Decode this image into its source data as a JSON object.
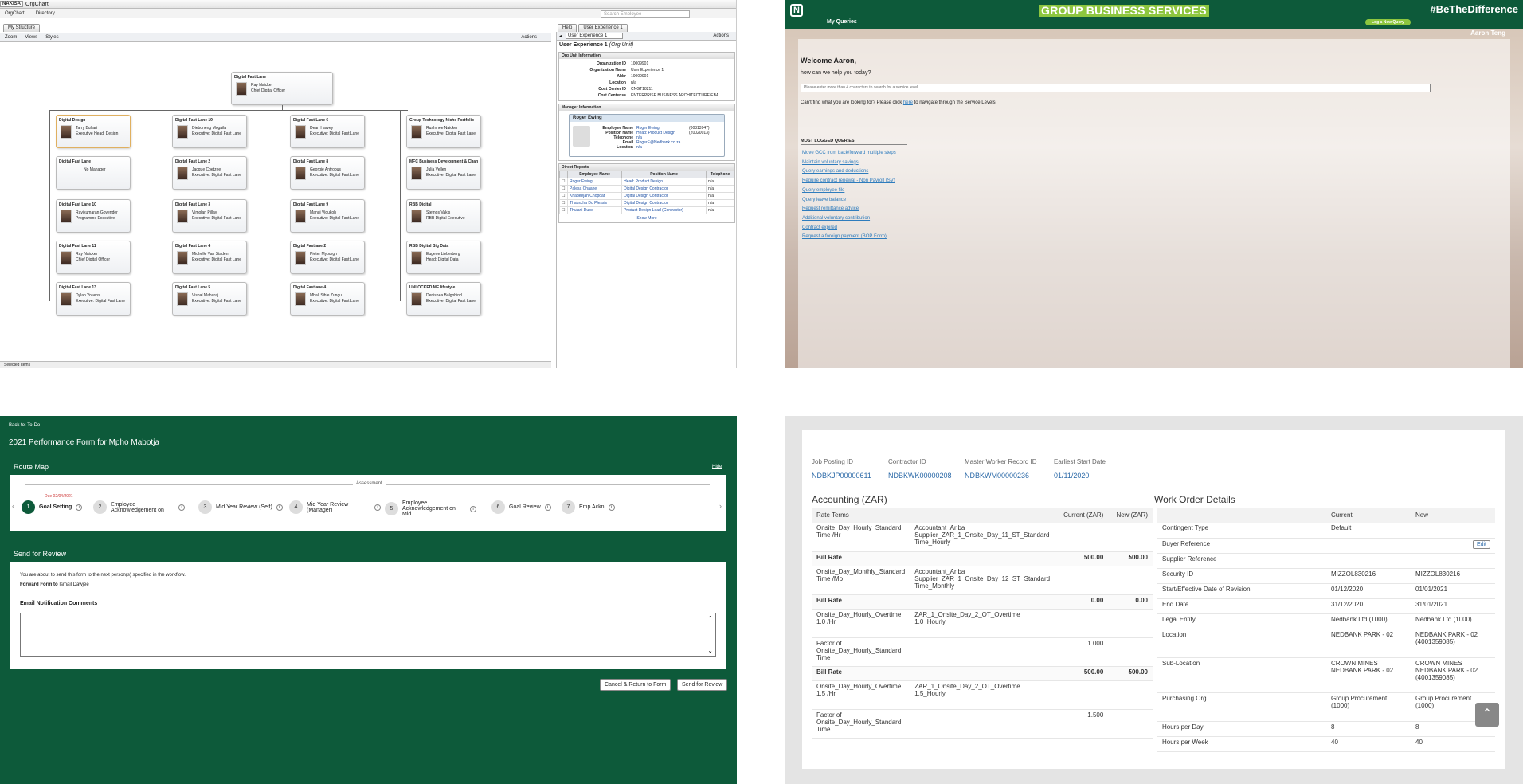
{
  "orgchart": {
    "logo": "NAKISA",
    "app_title": "OrgChart",
    "menu": [
      "OrgChart",
      "Directory"
    ],
    "search_placeholder": "Search Employee",
    "tab_structure": "My Structure",
    "tab_help": "Help",
    "tab_user_exp": "User Experience 1",
    "toolbar": {
      "zoom": "Zoom",
      "views": "Views",
      "styles": "Styles",
      "actions": "Actions"
    },
    "right_actions": "Actions",
    "root": {
      "title": "Digital Fast Lane",
      "name": "Ray Naicker",
      "role": "Chief Digital Officer"
    },
    "columns": [
      [
        {
          "title": "Digital Design",
          "name": "Tarry Buhari",
          "role": "Executive Head: Design"
        },
        {
          "title": "Digital Fast Lane",
          "name": "No Manager",
          "role": ""
        },
        {
          "title": "Digital Fast Lane 10",
          "name": "Ravikumaran Govender",
          "role": "Programme Executive"
        },
        {
          "title": "Digital Fast Lane 11",
          "name": "Ray Naicker",
          "role": "Chief Digital Officer"
        },
        {
          "title": "Digital Fast Lane 13",
          "name": "Dylan Youens",
          "role": "Executive: Digital Fast Lane"
        }
      ],
      [
        {
          "title": "Digital Fast Lane 19",
          "name": "Dieboneng Mogaila",
          "role": "Executive: Digital Fast Lane"
        },
        {
          "title": "Digital Fast Lane 2",
          "name": "Jacque Coetzee",
          "role": "Executive: Digital Fast Lane"
        },
        {
          "title": "Digital Fast Lane 3",
          "name": "Vimolan Pillay",
          "role": "Executive: Digital Fast Lane"
        },
        {
          "title": "Digital Fast Lane 4",
          "name": "Michelle Van Staden",
          "role": "Executive: Digital Fast Lane"
        },
        {
          "title": "Digital Fast Lane 5",
          "name": "Vishal Maharaj",
          "role": "Executive: Digital Fast Lane"
        }
      ],
      [
        {
          "title": "Digital Fast Lane 6",
          "name": "Dean Harvey",
          "role": "Executive: Digital Fast Lane"
        },
        {
          "title": "Digital Fast Lane 8",
          "name": "Georgie Antrobus",
          "role": "Executive: Digital Fast Lane"
        },
        {
          "title": "Digital Fast Lane 9",
          "name": "Manuj Vidukoh",
          "role": "Executive: Digital Fast Lane"
        },
        {
          "title": "Digital Fastlane 2",
          "name": "Pieter Myburgh",
          "role": "Executive: Digital Fast Lane"
        },
        {
          "title": "Digital Fastlane 4",
          "name": "Mbali Sihle Zungu",
          "role": "Executive: Digital Fast Lane"
        }
      ],
      [
        {
          "title": "Group Technology Niche Portfolio",
          "name": "Rushmee Naicker",
          "role": "Executive: Digital Fast Lane"
        },
        {
          "title": "MFC Business Development & Channel...",
          "name": "Julia Vellen",
          "role": "Executive: Digital Fast Lane"
        },
        {
          "title": "RBB Digital",
          "name": "Stefnos Vakis",
          "role": "RBB Digital Executive"
        },
        {
          "title": "RBB Digital Big Data",
          "name": "Eugene Lieberberg",
          "role": "Head: Digital Data"
        },
        {
          "title": "UNLOCKED.ME lifestyle",
          "name": "Denishea Balgobind",
          "role": "Executive: Digital Fast Lane"
        }
      ]
    ],
    "status": "Selected Items",
    "detail": {
      "title": "User Experience 1",
      "subtitle": "(Org Unit)",
      "org_header": "Org Unit Information",
      "org_info": [
        {
          "k": "Organization ID",
          "v": "10009901"
        },
        {
          "k": "Organization Name",
          "v": "User Experience 1"
        },
        {
          "k": "Abbr",
          "v": "10009901"
        },
        {
          "k": "Location",
          "v": "n/a"
        },
        {
          "k": "Cost Center ID",
          "v": "CNGT18211"
        },
        {
          "k": "Cost Center ss",
          "v": "ENTERPRISE BUSINESS ARCHITECTURE/EBA"
        }
      ],
      "mgr_tab": "Manager",
      "mgr_header": "Manager Information",
      "mgr_name": "Roger Ewing",
      "mgr_info": [
        {
          "k": "Employee Name",
          "v": "Roger Ewing",
          "x": "(00313947)"
        },
        {
          "k": "Position Name",
          "v": "Head: Product Design",
          "x": "(20020013)"
        },
        {
          "k": "Telephone",
          "v": "n/a",
          "x": ""
        },
        {
          "k": "Email",
          "v": "RogerE@Nedbank.co.za",
          "x": ""
        },
        {
          "k": "Location",
          "v": "n/a",
          "x": ""
        }
      ],
      "dr_header": "Direct Reports",
      "dr_cols": [
        "Employee Name",
        "Position Name",
        "Telephone"
      ],
      "dr_rows": [
        [
          "Roger Ewing",
          "Head: Product Design",
          "n/a"
        ],
        [
          "Palesa Chaane",
          "Digital Design Contractor",
          "n/a"
        ],
        [
          "Khadeejah Chopdat",
          "Digital Design Contractor",
          "n/a"
        ],
        [
          "Thabscha Du Plessis",
          "Digital Design Contractor",
          "n/a"
        ],
        [
          "Thulani Dube",
          "Product Design Lead (Contractor)",
          "n/a"
        ]
      ],
      "show_more": "Show More"
    }
  },
  "gbs": {
    "title": "GROUP BUSINESS SERVICES",
    "hashtag": "#BeTheDifference",
    "nav": "My Queries",
    "log_button": "Log a New Query",
    "user": "Aaron Teng",
    "welcome": "Welcome Aaron,",
    "help": "how can we help you today?",
    "search_placeholder": "Please enter more than 4 characters to search for a service level...",
    "cant_find_pre": "Can't find what you are looking for? Please click",
    "here": "here",
    "cant_find_post": "to navigate through the Service Levels.",
    "most_logged": "MOST LOGGED QUERIES",
    "queries": [
      "Move GCC from back/forward multiple steps",
      "Maintain voluntary savings",
      "Query earnings and deductions",
      "Require contract renewal - Non Payroll (SV)",
      "Query employee file",
      "Query leave balance",
      "Request remittance advice",
      "Additional voluntary contribution",
      "Contract expired",
      "Request a foreign payment (BOP Form)"
    ]
  },
  "perf": {
    "back": "Back to: To-Do",
    "title": "2021 Performance Form for Mpho Mabotja",
    "route_map": "Route Map",
    "hide": "Hide",
    "assessment": "Assessment",
    "due": "Due 02/04/2021",
    "steps": [
      {
        "n": "1",
        "label": "Goal Setting"
      },
      {
        "n": "2",
        "label": "Employee Acknowledgement on"
      },
      {
        "n": "3",
        "label": "Mid Year Review (Self)"
      },
      {
        "n": "4",
        "label": "Mid Year Review (Manager)"
      },
      {
        "n": "5",
        "label": "Employee Acknowledgement on Mid..."
      },
      {
        "n": "6",
        "label": "Goal Review"
      },
      {
        "n": "7",
        "label": "Emp Ackn"
      }
    ],
    "send_title": "Send for Review",
    "about": "You are about to send this form to the next person(s) specified in the workflow.",
    "forward_label": "Forward Form to",
    "forward_to": "Ismail Dawjee",
    "email_label": "Email Notification Comments",
    "cancel_btn": "Cancel & Return to Form",
    "send_btn": "Send for Review"
  },
  "ariba": {
    "ids": [
      {
        "k": "Job Posting ID",
        "v": "NDBKJP00000611"
      },
      {
        "k": "Contractor ID",
        "v": "NDBKWK00000208"
      },
      {
        "k": "Master Worker Record ID",
        "v": "NDBKWM00000236"
      },
      {
        "k": "Earliest Start Date",
        "v": "01/11/2020"
      }
    ],
    "acc_title": "Accounting (ZAR)",
    "acc_cols": [
      "Rate Terms",
      "Current (ZAR)",
      "New (ZAR)"
    ],
    "acc_rows": [
      {
        "a": "Onsite_Day_Hourly_Standard Time /Hr",
        "b": "Accountant_Ariba Supplier_ZAR_1_Onsite_Day_11_ST_Standard Time_Hourly",
        "c": "",
        "bold": false
      },
      {
        "a": "Bill Rate",
        "b": "",
        "c": "500.00",
        "d": "500.00",
        "bold": true
      },
      {
        "a": "Onsite_Day_Monthly_Standard Time /Mo",
        "b": "Accountant_Ariba Supplier_ZAR_1_Onsite_Day_12_ST_Standard Time_Monthly",
        "c": "",
        "bold": false
      },
      {
        "a": "Bill Rate",
        "b": "",
        "c": "0.00",
        "d": "0.00",
        "bold": true
      },
      {
        "a": "Onsite_Day_Hourly_Overtime 1.0 /Hr",
        "b": "ZAR_1_Onsite_Day_2_OT_Overtime 1.0_Hourly",
        "c": "",
        "bold": false
      },
      {
        "a": "Factor of Onsite_Day_Hourly_Standard Time",
        "b": "",
        "c": "1.000",
        "d": "",
        "bold": false
      },
      {
        "a": "Bill Rate",
        "b": "",
        "c": "500.00",
        "d": "500.00",
        "bold": true
      },
      {
        "a": "Onsite_Day_Hourly_Overtime 1.5 /Hr",
        "b": "ZAR_1_Onsite_Day_2_OT_Overtime 1.5_Hourly",
        "c": "",
        "bold": false
      },
      {
        "a": "Factor of Onsite_Day_Hourly_Standard Time",
        "b": "",
        "c": "1.500",
        "d": "",
        "bold": false
      }
    ],
    "wo_title": "Work Order Details",
    "wo_cols": [
      "",
      "Current",
      "New"
    ],
    "wo_rows": [
      [
        "Contingent Type",
        "Default",
        ""
      ],
      [
        "Buyer Reference",
        "",
        ""
      ],
      [
        "Supplier Reference",
        "",
        ""
      ],
      [
        "Security ID",
        "MIZZOL830216",
        "MIZZOL830216"
      ],
      [
        "Start/Effective Date of Revision",
        "01/12/2020",
        "01/01/2021"
      ],
      [
        "End Date",
        "31/12/2020",
        "31/01/2021"
      ],
      [
        "Legal Entity",
        "Nedbank Ltd (1000)",
        "Nedbank Ltd (1000)"
      ],
      [
        "Location",
        "NEDBANK PARK - 02",
        "NEDBANK PARK - 02 (4001359085)"
      ],
      [
        "Sub-Location",
        "CROWN MINES NEDBANK PARK - 02",
        "CROWN MINES NEDBANK PARK - 02 (4001359085)"
      ],
      [
        "Purchasing Org",
        "Group Procurement (1000)",
        "Group Procurement (1000)"
      ],
      [
        "Hours per Day",
        "8",
        "8"
      ],
      [
        "Hours per Week",
        "40",
        "40"
      ]
    ],
    "edit": "Edit"
  }
}
